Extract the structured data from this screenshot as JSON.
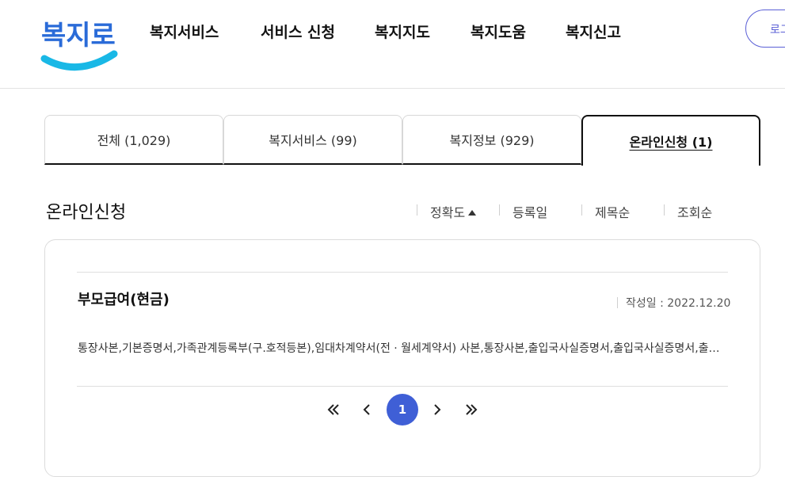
{
  "header": {
    "logo_text": "복지로",
    "nav": [
      "복지서비스",
      "서비스 신청",
      "복지지도",
      "복지도움",
      "복지신고"
    ],
    "login_label": "로그"
  },
  "tabs": [
    {
      "label": "전체  (1,029)",
      "active": false
    },
    {
      "label": "복지서비스 (99)",
      "active": false
    },
    {
      "label": "복지정보 (929)",
      "active": false
    },
    {
      "label": "온라인신청 (1)",
      "active": true
    }
  ],
  "section": {
    "title": "온라인신청",
    "sort": [
      {
        "label": "정확도",
        "active": true
      },
      {
        "label": "등록일",
        "active": false
      },
      {
        "label": "제목순",
        "active": false
      },
      {
        "label": "조회순",
        "active": false
      }
    ]
  },
  "results": [
    {
      "title": "부모급여(현금)",
      "date_label": "작성일 : ",
      "date": "2022.12.20",
      "description": "통장사본,기본증명서,가족관계등록부(구.호적등본),임대차계약서(전 · 월세계약서) 사본,통장사본,출입국사실증명서,출입국사실증명서,출입국사실증명서"
    }
  ],
  "pagination": {
    "current": "1",
    "first_icon": "double-chevron-left-icon",
    "prev_icon": "chevron-left-icon",
    "next_icon": "chevron-right-icon",
    "last_icon": "double-chevron-right-icon"
  },
  "colors": {
    "logo_blue": "#2a6bd8",
    "logo_cyan": "#19b8e6",
    "accent": "#3f5fd6",
    "login_border": "#5a5fd6"
  }
}
